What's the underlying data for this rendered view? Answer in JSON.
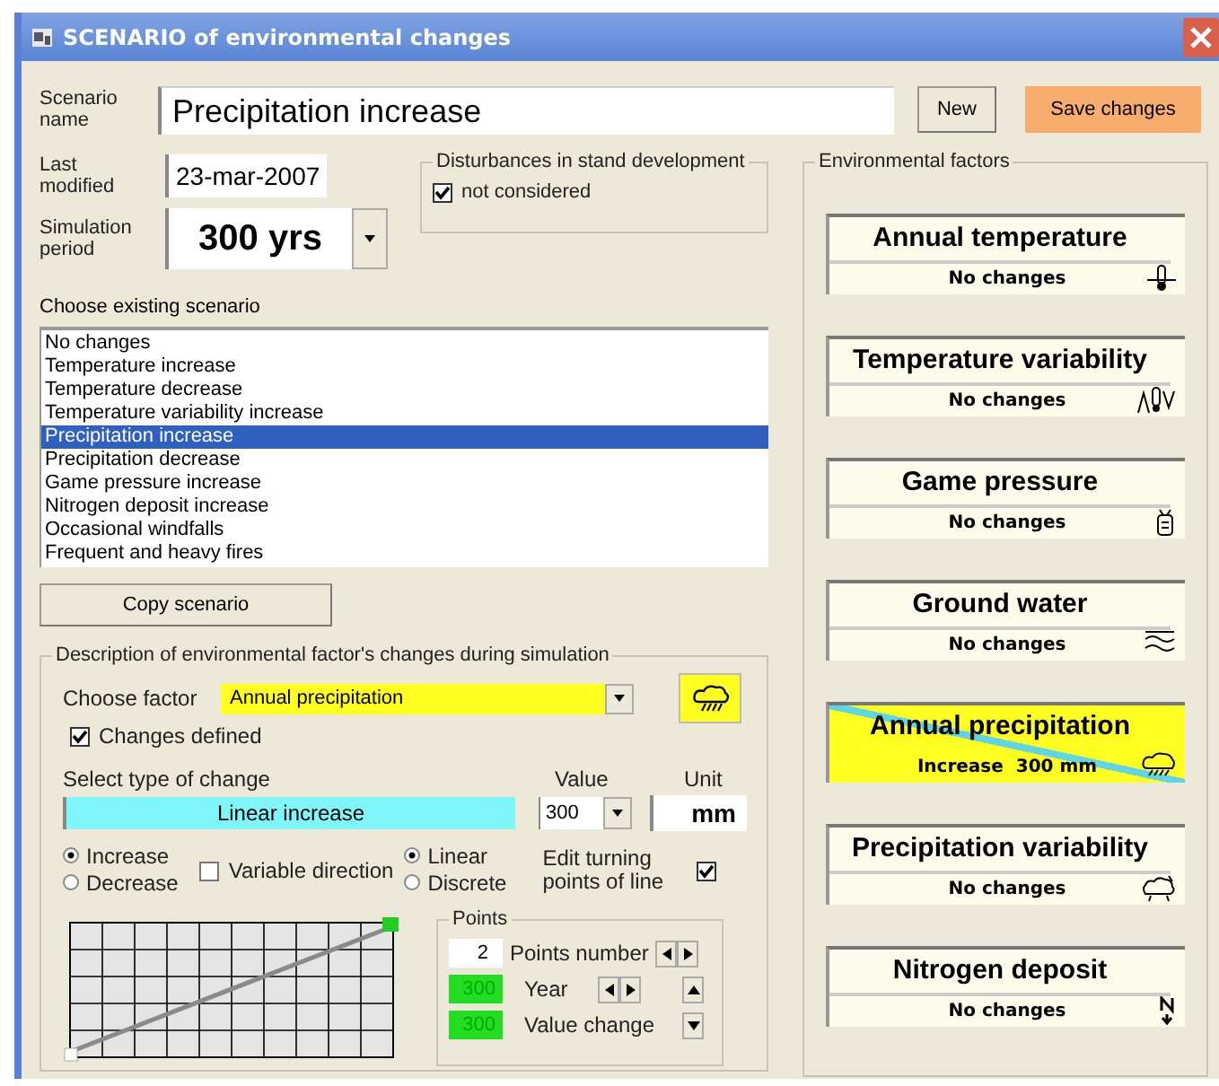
{
  "window": {
    "title": "SCENARIO of environmental changes"
  },
  "scenario": {
    "name_label": "Scenario name",
    "name": "Precipitation increase",
    "modified_label": "Last modified",
    "modified": "23-mar-2007",
    "period_label": "Simulation period",
    "period": "300 yrs"
  },
  "buttons": {
    "new": "New",
    "save": "Save changes"
  },
  "disturbances": {
    "title": "Disturbances in stand development",
    "label": "not considered",
    "checked": true
  },
  "scenario_list": {
    "label": "Choose existing scenario",
    "items": [
      {
        "label": "No changes",
        "selected": false
      },
      {
        "label": "Temperature increase",
        "selected": false
      },
      {
        "label": "Temperature decrease",
        "selected": false
      },
      {
        "label": "Temperature variability increase",
        "selected": false
      },
      {
        "label": "Precipitation increase",
        "selected": true
      },
      {
        "label": "Precipitation decrease",
        "selected": false
      },
      {
        "label": "Game pressure increase",
        "selected": false
      },
      {
        "label": "Nitrogen deposit increase",
        "selected": false
      },
      {
        "label": "Occasional windfalls",
        "selected": false
      },
      {
        "label": "Frequent and heavy fires",
        "selected": false
      }
    ]
  },
  "copy_button": "Copy scenario",
  "description": {
    "title": "Description of environmental factor's changes during simulation",
    "factor_label": "Choose factor",
    "factor": "Annual precipitation",
    "changes_defined": {
      "label": "Changes defined",
      "checked": true
    },
    "type_label": "Select type of change",
    "type": "Linear increase",
    "value_label": "Value",
    "value": "300",
    "unit_label": "Unit",
    "unit": "mm",
    "direction": [
      {
        "label": "Increase",
        "selected": true
      },
      {
        "label": "Decrease",
        "selected": false
      }
    ],
    "variable_direction": {
      "label": "Variable direction",
      "checked": false
    },
    "shape": [
      {
        "label": "Linear",
        "selected": true
      },
      {
        "label": "Discrete",
        "selected": false
      }
    ],
    "edit_points": {
      "label": "Edit turning points of line",
      "checked": true
    },
    "points": {
      "title": "Points",
      "number": "2",
      "number_label": "Points number",
      "year": "300",
      "year_label": "Year",
      "value": "300",
      "value_label": "Value change"
    }
  },
  "factors": {
    "title": "Environmental factors",
    "items": [
      {
        "title": "Annual temperature",
        "status": "No changes",
        "selected": false
      },
      {
        "title": "Temperature variability",
        "status": "No changes",
        "selected": false
      },
      {
        "title": "Game pressure",
        "status": "No changes",
        "selected": false
      },
      {
        "title": "Ground water",
        "status": "No changes",
        "selected": false
      },
      {
        "title": "Annual precipitation",
        "status": "Increase  300 mm",
        "selected": true
      },
      {
        "title": "Precipitation variability",
        "status": "No changes",
        "selected": false
      },
      {
        "title": "Nitrogen deposit",
        "status": "No changes",
        "selected": false
      }
    ]
  }
}
